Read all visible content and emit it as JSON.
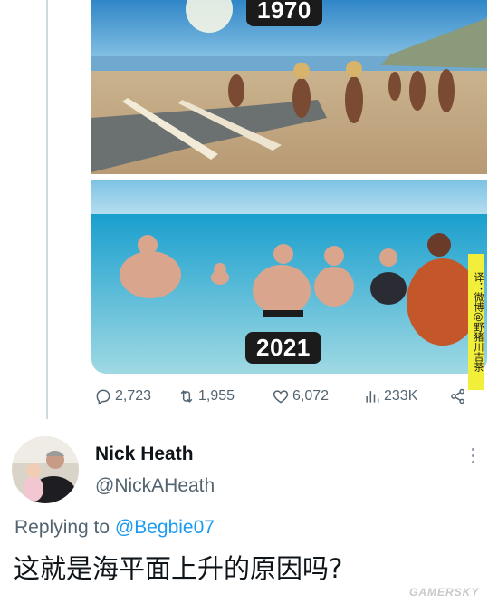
{
  "tweet": {
    "media": {
      "top_label": "1970",
      "bottom_label": "2021",
      "translator_credit": "译：微博@野猪川吉茶"
    },
    "stats": {
      "replies": "2,723",
      "retweets": "1,955",
      "likes": "6,072",
      "views": "233K"
    },
    "icons": [
      "reply-icon",
      "retweet-icon",
      "like-icon",
      "views-icon",
      "share-icon"
    ]
  },
  "reply": {
    "name": "Nick Heath",
    "handle": "@NickAHeath",
    "replying_prefix": "Replying to ",
    "replying_to": "@Begbie07",
    "text": "这就是海平面上升的原因吗?"
  },
  "watermark": "GAMERSKY",
  "colors": {
    "accent": "#1d9bf0",
    "muted": "#536471",
    "thread_line": "#cfd9de"
  }
}
